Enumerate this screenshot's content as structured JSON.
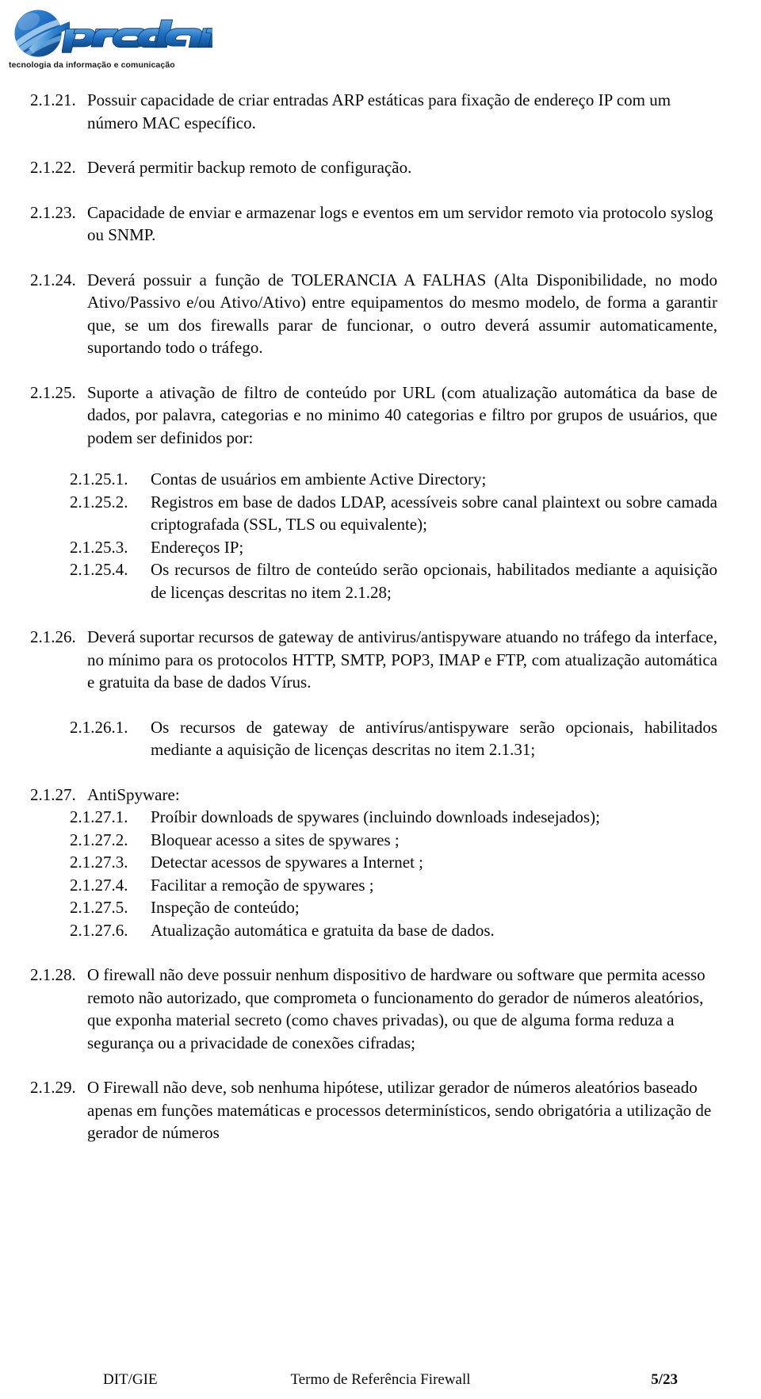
{
  "header": {
    "logo_text": "prodam",
    "logo_tagline": "tecnologia da informação e comunicação",
    "brand_color": "#1f6fc4",
    "brand_color_dark": "#16528f"
  },
  "document": {
    "items": [
      {
        "id": "item-2-1-21",
        "level": 1,
        "number": "2.1.21.",
        "text": "Possuir capacidade de criar entradas ARP estáticas para fixação de endereço IP com um número MAC específico.",
        "justify": false
      },
      {
        "id": "item-2-1-22",
        "level": 1,
        "number": "2.1.22.",
        "text": "Deverá permitir backup remoto de configuração.",
        "justify": false
      },
      {
        "id": "item-2-1-23",
        "level": 1,
        "number": "2.1.23.",
        "text": "Capacidade de enviar e armazenar logs e eventos em um servidor remoto via protocolo syslog ou SNMP.",
        "justify": false
      },
      {
        "id": "item-2-1-24",
        "level": 1,
        "number": "2.1.24.",
        "text": "Deverá possuir a função de TOLERANCIA A FALHAS (Alta Disponibilidade, no modo Ativo/Passivo e/ou Ativo/Ativo) entre equipamentos do mesmo modelo, de forma a garantir que, se um dos firewalls parar de funcionar, o outro deverá assumir automaticamente, suportando todo o tráfego.",
        "justify": true
      },
      {
        "id": "item-2-1-25",
        "level": 1,
        "number": "2.1.25.",
        "text": "Suporte a ativação de filtro de conteúdo por URL (com atualização automática da base de dados, por palavra, categorias e no minimo 40 categorias e filtro por grupos de usuários, que podem ser definidos por:",
        "justify": true
      },
      {
        "id": "item-2-1-25-1",
        "level": 2,
        "number": "2.1.25.1.",
        "text": "Contas de usuários em ambiente Active Directory;",
        "justify": false
      },
      {
        "id": "item-2-1-25-2",
        "level": 2,
        "number": "2.1.25.2.",
        "text": "Registros em base de dados LDAP, acessíveis sobre canal plaintext ou sobre camada criptografada (SSL, TLS ou equivalente);",
        "justify": true
      },
      {
        "id": "item-2-1-25-3",
        "level": 2,
        "number": "2.1.25.3.",
        "text": "Endereços IP;",
        "justify": false
      },
      {
        "id": "item-2-1-25-4",
        "level": 2,
        "number": "2.1.25.4.",
        "text": "Os recursos de filtro de conteúdo serão opcionais, habilitados mediante a aquisição de licenças descritas no item 2.1.28;",
        "justify": true
      },
      {
        "id": "item-2-1-26",
        "level": 1,
        "number": "2.1.26.",
        "text": "Deverá suportar recursos de gateway de antivirus/antispyware atuando no tráfego da interface, no mínimo para os protocolos HTTP, SMTP, POP3, IMAP e FTP, com atualização automática e gratuita da base de dados Vírus.",
        "justify": true
      },
      {
        "id": "item-2-1-26-1",
        "level": 2,
        "number": "2.1.26.1.",
        "text": "Os recursos de gateway de antivírus/antispyware serão opcionais, habilitados mediante a aquisição de licenças descritas no item 2.1.31;",
        "justify": true
      },
      {
        "id": "item-2-1-27",
        "level": 1,
        "number": "2.1.27.",
        "text": "AntiSpyware:",
        "justify": false
      },
      {
        "id": "item-2-1-27-1",
        "level": 2,
        "number": "2.1.27.1.",
        "text": "Proíbir downloads de spywares (incluindo downloads indesejados);",
        "justify": false
      },
      {
        "id": "item-2-1-27-2",
        "level": 2,
        "number": "2.1.27.2.",
        "text": "Bloquear acesso a sites de spywares ;",
        "justify": false
      },
      {
        "id": "item-2-1-27-3",
        "level": 2,
        "number": "2.1.27.3.",
        "text": "Detectar acessos de spywares a Internet ;",
        "justify": false
      },
      {
        "id": "item-2-1-27-4",
        "level": 2,
        "number": "2.1.27.4.",
        "text": "Facilitar a remoção de spywares ;",
        "justify": false
      },
      {
        "id": "item-2-1-27-5",
        "level": 2,
        "number": "2.1.27.5.",
        "text": "Inspeção de conteúdo;",
        "justify": false
      },
      {
        "id": "item-2-1-27-6",
        "level": 2,
        "number": "2.1.27.6.",
        "text": "Atualização automática e gratuita da base de dados.",
        "justify": false
      },
      {
        "id": "item-2-1-28",
        "level": 1,
        "number": "2.1.28.",
        "text": "O firewall não deve possuir nenhum dispositivo de hardware ou software que permita acesso remoto não autorizado, que comprometa o funcionamento do gerador de números aleatórios, que exponha material secreto (como chaves privadas), ou que de alguma forma reduza a segurança ou a privacidade de conexões cifradas;",
        "justify": false
      },
      {
        "id": "item-2-1-29",
        "level": 1,
        "number": "2.1.29.",
        "text": "O Firewall não deve, sob nenhuma hipótese, utilizar gerador de números aleatórios baseado apenas em funções matemáticas e processos determinísticos, sendo obrigatória a utilização de gerador de números",
        "justify": false
      }
    ]
  },
  "footer": {
    "left": "DIT/GIE",
    "center": "Termo de Referência Firewall",
    "right": "5/23"
  }
}
